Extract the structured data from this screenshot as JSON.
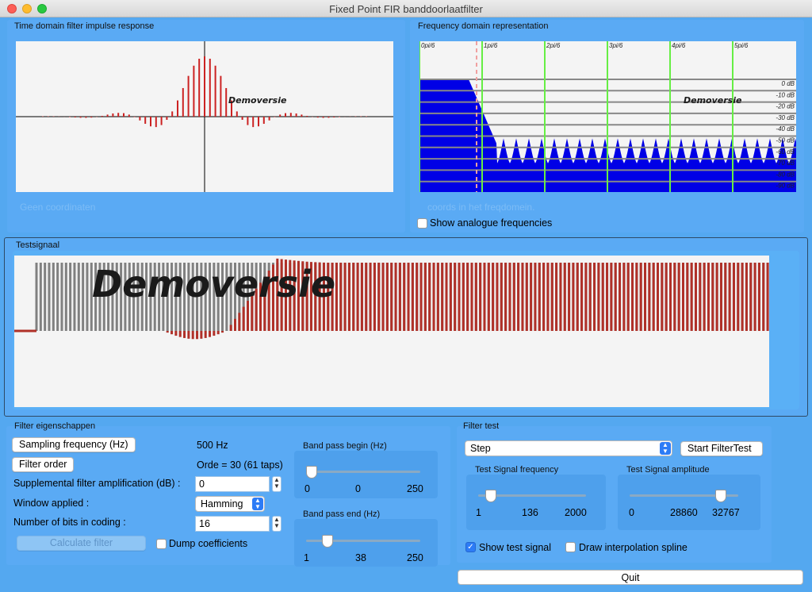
{
  "window": {
    "title": "Fixed Point FIR banddoorlaatfilter"
  },
  "watermark": "Demoversie",
  "colors": {
    "background": "#54a8f0",
    "impulse_stem": "#cc2222",
    "spectrum_fill": "#0000e6",
    "freq_marker": "#66ee44",
    "input_signal": "#808080",
    "output_signal": "#b03028"
  },
  "time_panel": {
    "title": "Time domain filter impulse response",
    "coords_text": "Geen coordinaten"
  },
  "freq_panel": {
    "title": "Frequency domain representation",
    "coords_text": "coords in het freqdomein.",
    "freq_labels": [
      "0pi/6",
      "1pi/6",
      "2pi/6",
      "3pi/6",
      "4pi/6",
      "5pi/6"
    ],
    "db_labels": [
      "0 dB",
      "-10 dB",
      "-20 dB",
      "-30 dB",
      "-40 dB",
      "-50 dB",
      "-60 dB",
      "-70 dB",
      "-80 dB",
      "-90 dB"
    ],
    "show_analogue_label": "Show analogue frequencies",
    "show_analogue_checked": false
  },
  "test_signal_panel": {
    "title": "Testsignaal"
  },
  "filter_props": {
    "title": "Filter eigenschappen",
    "sampling_button": "Sampling frequency (Hz)",
    "sampling_value": "500 Hz",
    "order_button": "Filter order",
    "order_value": "Orde = 30 (61 taps)",
    "amp_label": "Supplemental filter amplification (dB) :",
    "amp_value": "0",
    "window_label": "Window applied :",
    "window_value": "Hamming",
    "bits_label": "Number of bits in coding :",
    "bits_value": "16",
    "calculate_button": "Calculate filter",
    "dump_label": "Dump coefficients",
    "dump_checked": false,
    "bp_begin": {
      "title": "Band pass begin (Hz)",
      "min": "0",
      "value": "0",
      "max": "250",
      "fraction": 0.0
    },
    "bp_end": {
      "title": "Band pass end (Hz)",
      "min": "1",
      "value": "38",
      "max": "250",
      "fraction": 0.15
    }
  },
  "filter_test": {
    "title": "Filter test",
    "signal_type": "Step",
    "start_button": "Start FilterTest",
    "freq": {
      "title": "Test Signal frequency",
      "min": "1",
      "value": "136",
      "max": "2000",
      "fraction": 0.07
    },
    "amp": {
      "title": "Test Signal amplitude",
      "min": "0",
      "value": "28860",
      "max": "32767",
      "fraction": 0.88
    },
    "show_test_label": "Show test signal",
    "show_test_checked": true,
    "interp_label": "Draw interpolation spline",
    "interp_checked": false
  },
  "quit_button": "Quit"
}
